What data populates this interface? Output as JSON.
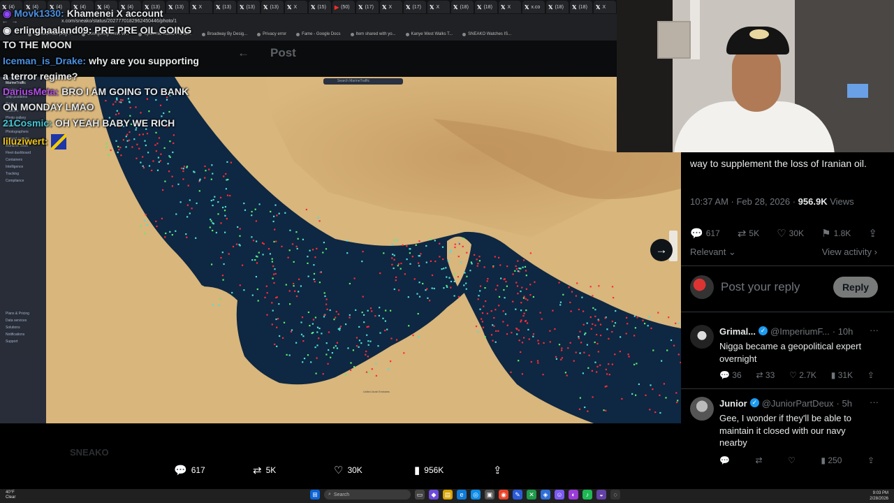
{
  "browser": {
    "tabs": [
      {
        "icon": "x-logo",
        "label": "(4)"
      },
      {
        "icon": "x-logo",
        "label": "(4)"
      },
      {
        "icon": "x-logo",
        "label": "(4)"
      },
      {
        "icon": "x-logo",
        "label": "(4)"
      },
      {
        "icon": "x-logo",
        "label": "(4)"
      },
      {
        "icon": "x-logo",
        "label": "(4)"
      },
      {
        "icon": "x-logo",
        "label": "(13)"
      },
      {
        "icon": "x-logo",
        "label": "(13)"
      },
      {
        "icon": "x-logo",
        "label": "X"
      },
      {
        "icon": "x-logo",
        "label": "(13)"
      },
      {
        "icon": "x-logo",
        "label": "(13)"
      },
      {
        "icon": "x-logo",
        "label": "(13)"
      },
      {
        "icon": "x-logo",
        "label": "X"
      },
      {
        "icon": "x-logo",
        "label": "(15)"
      },
      {
        "icon": "youtube-logo",
        "label": "(50)"
      },
      {
        "icon": "x-logo",
        "label": "(17)"
      },
      {
        "icon": "x-logo",
        "label": "X"
      },
      {
        "icon": "x-logo",
        "label": "(17)"
      },
      {
        "icon": "x-logo",
        "label": "X"
      },
      {
        "icon": "x-logo",
        "label": "(18)"
      },
      {
        "icon": "x-logo",
        "label": "(18)"
      },
      {
        "icon": "x-logo",
        "label": "X"
      },
      {
        "icon": "x-logo",
        "label": "x.co"
      },
      {
        "icon": "x-logo",
        "label": "(18)"
      },
      {
        "icon": "x-logo",
        "label": "(18)"
      },
      {
        "icon": "x-logo",
        "label": "X"
      }
    ],
    "url": "x.com/sneako/status/2027770182962450446/photo/1",
    "bookmarks": [
      "Camera Raw plug-...",
      "Configuring Sonic W...",
      "Epidemic Studio Pro 5E...",
      "Broadway By Desig...",
      "Privacy error",
      "Fame - Google Docs",
      "Item shared with yo...",
      "Kanye West Walks T...",
      "SNEAKO Watches IS..."
    ]
  },
  "page": {
    "header_back": "←",
    "header_title": "Post",
    "faded_author": "SNEAKO"
  },
  "map": {
    "search_placeholder": "Search MarineTraffic",
    "brand": "MarineTraffic",
    "sidebar_items": [
      "Explore",
      "Ship positions",
      "Ports",
      "Stations",
      "Photo gallery",
      "Photos",
      "Photographers",
      "Upload a photo",
      "Maritime news",
      "Fleet dashboard",
      "Containers",
      "Intelligence",
      "Tracking",
      "Compliance",
      "Plans & Pricing",
      "Data services",
      "Solutions",
      "Notifications",
      "Support"
    ],
    "label_uae": "United Arab Emirates"
  },
  "post_metrics": {
    "replies": "617",
    "reposts": "5K",
    "likes": "30K",
    "views": "956K"
  },
  "chat": [
    {
      "user": "Movk1330:",
      "user_color": "#4a90e2",
      "text": "Khamenei X account"
    },
    {
      "user": "erlinghaaland09:",
      "user_color": "#ffffff",
      "text": "PRE PRE OIL GOING TO THE MOON",
      "badge": "twitch-badge"
    },
    {
      "user": "Iceman_is_Drake:",
      "user_color": "#4a90e2",
      "text": "why are you supporting a terror regime?"
    },
    {
      "user": "DariusMeta:",
      "user_color": "#b44fe8",
      "text": "BRO I AM GOING TO BANK ON MONDAY LMAO"
    },
    {
      "user": "21Cosmic:",
      "user_color": "#43c7d6",
      "text": "OH YEAH BABY WE RICH"
    },
    {
      "user": "liluziwert:",
      "user_color": "#f0c419",
      "text": ""
    }
  ],
  "chat_display": {
    "line1": "Movk1330:",
    "line1_text": "Khamenei X account",
    "line2a": "erlinghaaland09: PRE PRE OIL GOING",
    "line2b": "TO THE MOON",
    "line3a_user": "Iceman_is_Drake:",
    "line3a_text": "why are you supporting",
    "line3b": "a terror regime?",
    "line4a_user": "DariusMeta:",
    "line4a_text": "BRO I AM GOING TO BANK",
    "line4b": "ON MONDAY LMAO",
    "line5_user": "21Cosmic:",
    "line5_text": "OH YEAH BABY WE RICH",
    "line6_user": "liluziwert:"
  },
  "tweet": {
    "text_tail": "way to supplement the loss of Iranian oil.",
    "time": "10:37 AM · Feb 28, 2026 ·",
    "views": "956.9K",
    "views_label": "Views",
    "replies": "617",
    "reposts": "5K",
    "likes": "30K",
    "bookmarks": "1.8K",
    "sort_label": "Relevant",
    "view_activity": "View activity",
    "reply_placeholder": "Post your reply",
    "reply_button": "Reply"
  },
  "comments": [
    {
      "name": "Grimal...",
      "handle": "@ImperiumF...",
      "time": "· 10h",
      "text": "Nigga became a geopolitical expert overnight",
      "replies": "36",
      "reposts": "33",
      "likes": "2.7K",
      "views": "31K"
    },
    {
      "name": "Junior",
      "handle": "@JuniorPartDeux",
      "time": "· 5h",
      "text": "Gee, I wonder if they'll be able to maintain it closed with our navy nearby",
      "replies": "",
      "reposts": "",
      "likes": "",
      "views": "250"
    }
  ],
  "taskbar": {
    "weather_temp": "40°F",
    "weather_desc": "Clear",
    "search": "Search",
    "time": "9:03 PM",
    "date": "2/28/2026"
  },
  "colors": {
    "x_blue": "#1d9bf0",
    "muted": "#71767b",
    "gulf_water": "#0e2742",
    "land": "#d7b47a",
    "ship_red": "#ff2b3a",
    "ship_cyan": "#4fe0d6",
    "ship_green": "#5cf06a"
  }
}
